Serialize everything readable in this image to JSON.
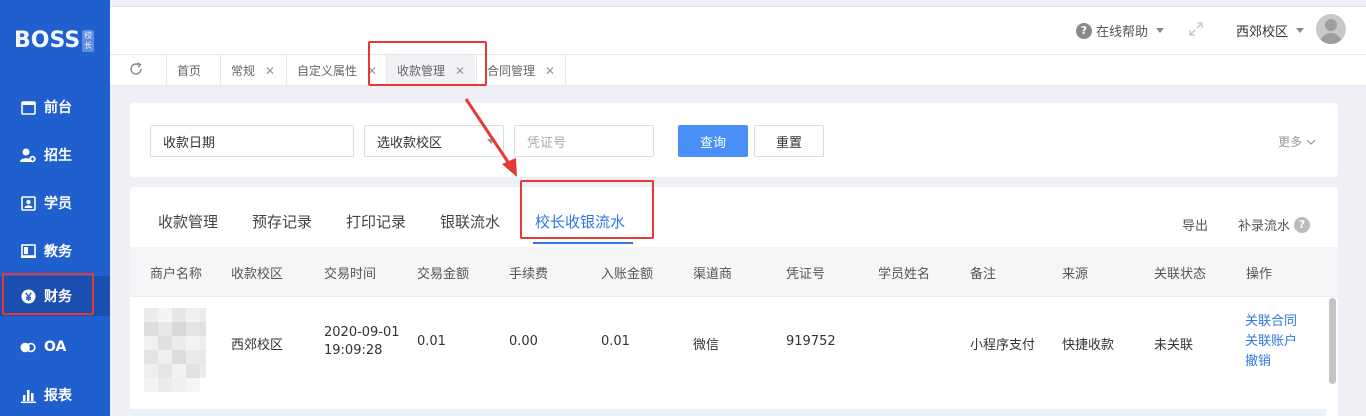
{
  "sidebar": {
    "logo": "BOSS",
    "logo_tag": "校长",
    "items": [
      {
        "label": "前台",
        "icon": "calendar-icon"
      },
      {
        "label": "招生",
        "icon": "user-add-icon"
      },
      {
        "label": "学员",
        "icon": "id-card-icon"
      },
      {
        "label": "教务",
        "icon": "book-icon"
      },
      {
        "label": "财务",
        "icon": "yen-icon"
      },
      {
        "label": "OA",
        "icon": "link-icon"
      },
      {
        "label": "报表",
        "icon": "bar-chart-icon"
      }
    ]
  },
  "topbar": {
    "help": "在线帮助",
    "campus": "西郊校区"
  },
  "page_tabs": [
    {
      "label": "首页",
      "closable": false
    },
    {
      "label": "常规",
      "closable": true
    },
    {
      "label": "自定义属性",
      "closable": true
    },
    {
      "label": "收款管理",
      "closable": true
    },
    {
      "label": "合同管理",
      "closable": true
    }
  ],
  "filter": {
    "date_placeholder": "收款日期",
    "campus_select": "选收款校区",
    "voucher_placeholder": "凭证号",
    "query": "查询",
    "reset": "重置",
    "more": "更多"
  },
  "subtabs": [
    "收款管理",
    "预存记录",
    "打印记录",
    "银联流水",
    "校长收银流水"
  ],
  "actions": {
    "export": "导出",
    "supplement": "补录流水"
  },
  "table": {
    "columns": [
      "商户名称",
      "收款校区",
      "交易时间",
      "交易金额",
      "手续费",
      "入账金额",
      "渠道商",
      "凭证号",
      "学员姓名",
      "备注",
      "来源",
      "关联状态",
      "操作"
    ],
    "row": {
      "campus": "西郊校区",
      "date": "2020-09-01",
      "time": "19:09:28",
      "amount": "0.01",
      "fee": "0.00",
      "net": "0.01",
      "channel": "微信",
      "voucher": "919752",
      "student": "",
      "remark": "小程序支付",
      "source": "快捷收款",
      "status": "未关联",
      "ops": [
        "关联合同",
        "关联账户",
        "撤销"
      ]
    }
  },
  "colors": {
    "sidebar": "#1f5fce",
    "primary": "#4a8ff5",
    "link": "#2e77e5",
    "highlight": "#e53935"
  }
}
